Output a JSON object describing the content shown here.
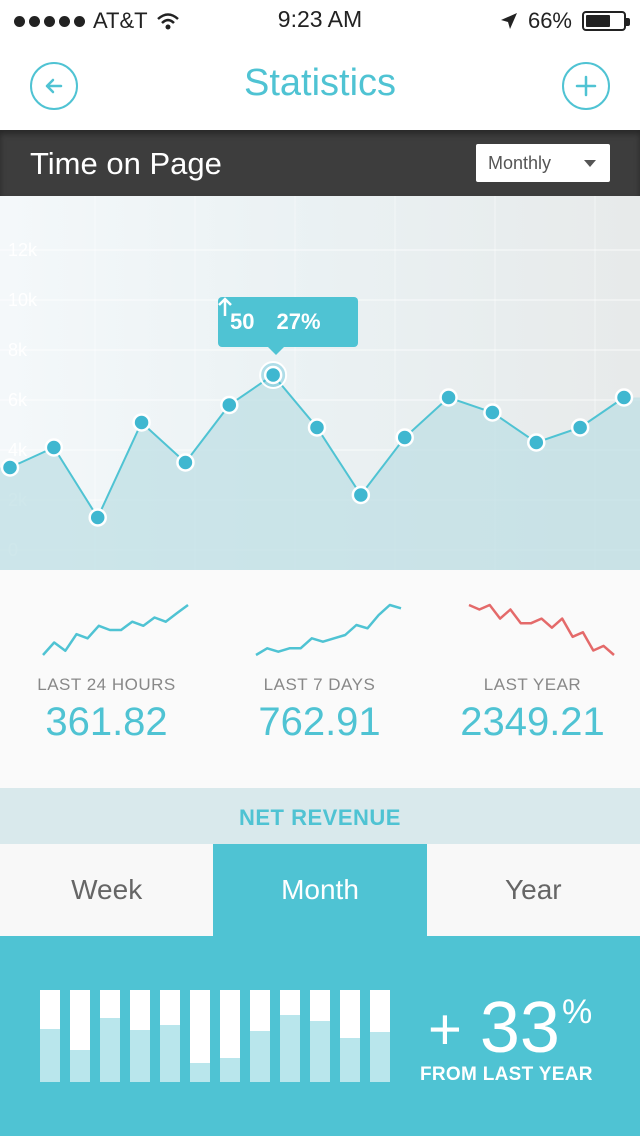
{
  "status_bar": {
    "carrier": "AT&T",
    "time": "9:23 AM",
    "battery": "66%",
    "battery_level": 0.66,
    "icons": [
      "signal-dots-icon",
      "wifi-icon",
      "location-arrow-icon",
      "battery-icon"
    ]
  },
  "nav": {
    "title": "Statistics",
    "back_icon": "back-arrow-icon",
    "add_icon": "plus-icon"
  },
  "section": {
    "title": "Time on Page",
    "dropdown_value": "Monthly"
  },
  "chart_data": {
    "type": "line",
    "ylabels": [
      "12k",
      "10k",
      "8k",
      "6k",
      "4k",
      "2k",
      "0"
    ],
    "ylim": [
      0,
      12000
    ],
    "grid": true,
    "values": [
      3300,
      4100,
      1300,
      5100,
      3500,
      5800,
      7000,
      4900,
      2200,
      4500,
      6100,
      5500,
      4300,
      4900,
      6100
    ],
    "highlight_index": 6,
    "tooltip": {
      "value": "50",
      "change": "27%",
      "direction": "up"
    },
    "colors": {
      "line": "#4fc3d3",
      "point": "#3fb7d0",
      "fill": "#bfdfe4"
    }
  },
  "stats": [
    {
      "label": "LAST 24 HOURS",
      "value": "361.82",
      "color": "#4fc3d3",
      "spark": [
        3,
        6,
        4,
        8,
        7,
        10,
        9,
        9,
        11,
        10,
        12,
        11,
        13,
        15
      ]
    },
    {
      "label": "LAST 7 DAYS",
      "value": "762.91",
      "color": "#4fc3d3",
      "spark": [
        3,
        5,
        4,
        5,
        5,
        8,
        7,
        8,
        9,
        12,
        11,
        15,
        18,
        17
      ]
    },
    {
      "label": "LAST YEAR",
      "value": "2349.21",
      "color": "#e46a6a",
      "spark": [
        18,
        17,
        18,
        15,
        17,
        14,
        14,
        15,
        13,
        15,
        11,
        12,
        8,
        9,
        7
      ]
    }
  ],
  "revenue": {
    "title": "NET REVENUE",
    "tabs": [
      "Week",
      "Month",
      "Year"
    ],
    "active_tab": 1,
    "bar_levels": [
      0.58,
      0.35,
      0.7,
      0.57,
      0.62,
      0.21,
      0.26,
      0.55,
      0.73,
      0.66,
      0.48,
      0.54
    ],
    "prefix": "+",
    "change_value": "33",
    "change_unit": "%",
    "change_caption": "FROM LAST YEAR"
  }
}
